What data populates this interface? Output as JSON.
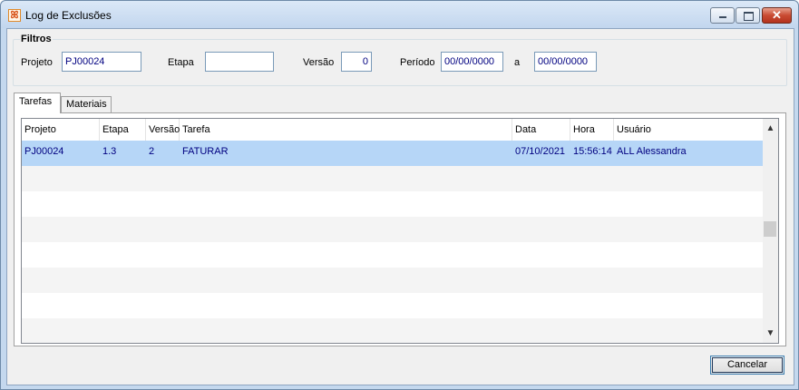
{
  "window": {
    "title": "Log de Exclusões",
    "app_icon_glyph": "ꕤ",
    "close_glyph": "✕"
  },
  "filters": {
    "group_title": "Filtros",
    "projeto_label": "Projeto",
    "projeto_value": "PJ00024",
    "etapa_label": "Etapa",
    "etapa_value": "",
    "versao_label": "Versão",
    "versao_value": "0",
    "periodo_label": "Período",
    "periodo_start": "00/00/0000",
    "periodo_sep": "a",
    "periodo_end": "00/00/0000"
  },
  "tabs": [
    {
      "label": "Tarefas"
    },
    {
      "label": "Materiais"
    }
  ],
  "grid": {
    "columns": [
      "Projeto",
      "Etapa",
      "Versão",
      "Tarefa",
      "Data",
      "Hora",
      "Usuário"
    ],
    "rows": [
      {
        "projeto": "PJ00024",
        "etapa": "1.3",
        "versao": "2",
        "tarefa": "FATURAR",
        "data": "07/10/2021",
        "hora": "15:56:14",
        "usuario": "ALL   Alessandra"
      }
    ]
  },
  "scrollbar": {
    "up_glyph": "▲",
    "down_glyph": "▼"
  },
  "buttons": {
    "cancel_label": "Cancelar"
  }
}
